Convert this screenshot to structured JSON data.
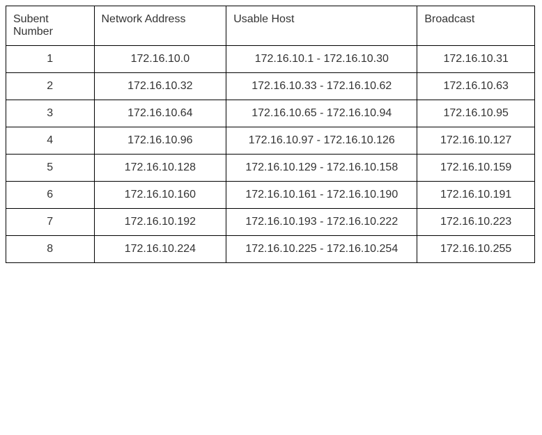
{
  "chart_data": {
    "type": "table",
    "headers": [
      "Subent Number",
      "Network Address",
      "Usable Host",
      "Broadcast"
    ],
    "rows": [
      {
        "subnet": "1",
        "network": "172.16.10.0",
        "host": "172.16.10.1 - 172.16.10.30",
        "broadcast": "172.16.10.31"
      },
      {
        "subnet": "2",
        "network": "172.16.10.32",
        "host": "172.16.10.33 - 172.16.10.62",
        "broadcast": "172.16.10.63"
      },
      {
        "subnet": "3",
        "network": "172.16.10.64",
        "host": "172.16.10.65 - 172.16.10.94",
        "broadcast": "172.16.10.95"
      },
      {
        "subnet": "4",
        "network": "172.16.10.96",
        "host": "172.16.10.97 - 172.16.10.126",
        "broadcast": "172.16.10.127"
      },
      {
        "subnet": "5",
        "network": "172.16.10.128",
        "host": "172.16.10.129 - 172.16.10.158",
        "broadcast": "172.16.10.159"
      },
      {
        "subnet": "6",
        "network": "172.16.10.160",
        "host": "172.16.10.161 - 172.16.10.190",
        "broadcast": "172.16.10.191"
      },
      {
        "subnet": "7",
        "network": "172.16.10.192",
        "host": "172.16.10.193 - 172.16.10.222",
        "broadcast": "172.16.10.223"
      },
      {
        "subnet": "8",
        "network": "172.16.10.224",
        "host": "172.16.10.225 - 172.16.10.254",
        "broadcast": "172.16.10.255"
      }
    ]
  }
}
